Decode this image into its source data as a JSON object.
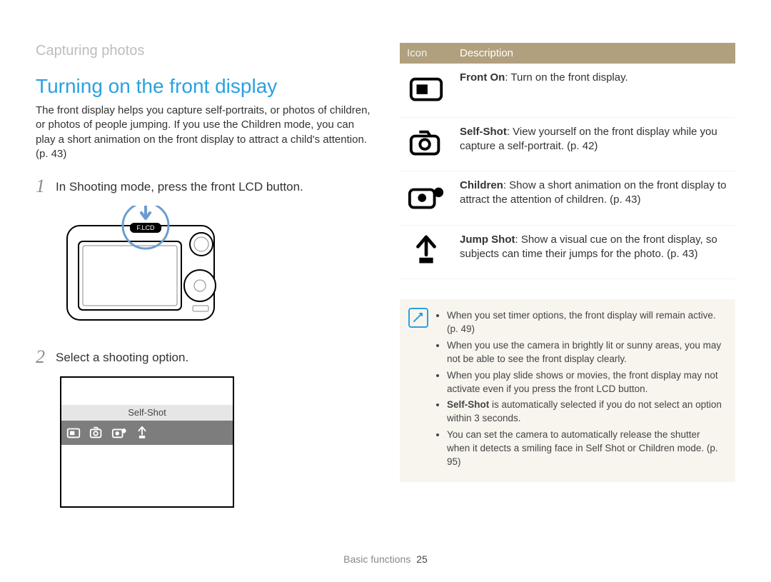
{
  "breadcrumb": "Capturing photos",
  "heading": "Turning on the front display",
  "intro": "The front display helps you capture self-portraits, or photos of children, or photos of people jumping. If you use the Children mode, you can play a short animation on the front display to attract a child's attention. (p. 43)",
  "steps": {
    "s1": {
      "num": "1",
      "text": "In Shooting mode, press the front LCD button."
    },
    "s2": {
      "num": "2",
      "text": "Select a shooting option."
    }
  },
  "camera_label": "F.LCD",
  "option_selected": "Self-Shot",
  "table": {
    "head_icon": "Icon",
    "head_desc": "Description",
    "rows": [
      {
        "bold": "Front On",
        "text": ": Turn on the front display."
      },
      {
        "bold": "Self-Shot",
        "text": ": View yourself on the front display while you capture a self-portrait. (p. 42)"
      },
      {
        "bold": "Children",
        "text": ": Show a short animation on the front display to attract the attention of children. (p. 43)"
      },
      {
        "bold": "Jump Shot",
        "text": ": Show a visual cue on the front display, so subjects can time their jumps for the photo. (p. 43)"
      }
    ]
  },
  "notes": [
    "When you set timer options, the front display will remain active. (p. 49)",
    "When you use the camera in brightly lit or sunny areas, you may not be able to see the front display clearly.",
    "When you play slide shows or movies, the front display may not activate even if you press the front LCD button.",
    "<b>Self-Shot</b> is automatically selected if you do not select an option within 3 seconds.",
    "You can set the camera to automatically release the shutter when it detects a smiling face in Self Shot or Children mode. (p. 95)"
  ],
  "footer_section": "Basic functions",
  "footer_page": "25"
}
